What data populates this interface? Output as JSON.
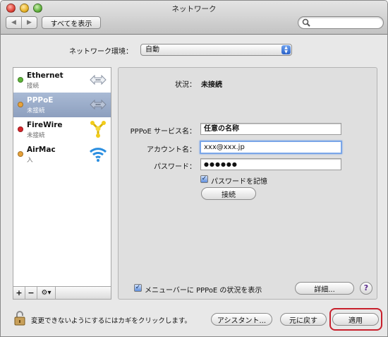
{
  "window": {
    "title": "ネットワーク"
  },
  "toolbar": {
    "show_all_label": "すべてを表示",
    "search_placeholder": ""
  },
  "location": {
    "label": "ネットワーク環境：",
    "selected": "自動"
  },
  "services": [
    {
      "name": "Ethernet",
      "status": "接続",
      "dot_color": "#5fb53a",
      "icon": "ethernet-arrows-icon"
    },
    {
      "name": "PPPoE",
      "status": "未接続",
      "dot_color": "#e8a23a",
      "icon": "pppoe-arrows-icon",
      "selected": true
    },
    {
      "name": "FireWire",
      "status": "未接続",
      "dot_color": "#d8262a",
      "icon": "firewire-icon"
    },
    {
      "name": "AirMac",
      "status": "入",
      "dot_color": "#e8a23a",
      "icon": "airmac-wifi-icon"
    }
  ],
  "sidebar_footer": {
    "add": "+",
    "remove": "−",
    "action": "⚙▾"
  },
  "detail": {
    "status_label": "状況：",
    "status_value": "未接続",
    "service_name_label": "PPPoE サービス名：",
    "service_name_value": "任意の名称",
    "account_label": "アカウント名：",
    "account_value": "xxx@xxx.jp",
    "password_label": "パスワード：",
    "password_value": "●●●●●●",
    "remember_label": "パスワードを記憶",
    "connect_label": "接続",
    "menubar_label": "メニューバーに PPPoE の状況を表示",
    "advanced_label": "詳細...",
    "help_label": "?"
  },
  "footer": {
    "lock_message": "変更できないようにするにはカギをクリックします。",
    "assistant_label": "アシスタント...",
    "revert_label": "元に戻す",
    "apply_label": "適用"
  },
  "colors": {
    "highlight": "#c8202c",
    "selection": "#8d9fbe"
  }
}
